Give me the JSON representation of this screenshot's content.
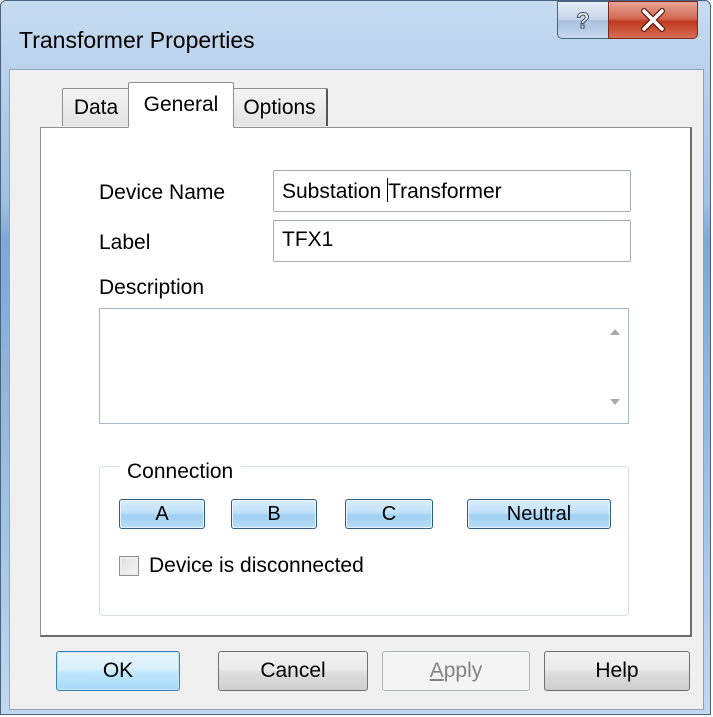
{
  "window": {
    "title": "Transformer Properties",
    "help_glyph": "?",
    "close_glyph": "X"
  },
  "tabs": [
    {
      "label": "Data"
    },
    {
      "label": "General"
    },
    {
      "label": "Options"
    }
  ],
  "general": {
    "device_name_label": "Device Name",
    "device_name_value_before_caret": "Substation ",
    "device_name_value_after_caret": "Transformer",
    "label_label": "Label",
    "label_value": "TFX1",
    "description_label": "Description",
    "description_value": ""
  },
  "connection": {
    "title": "Connection",
    "buttons": [
      {
        "label": "A"
      },
      {
        "label": "B"
      },
      {
        "label": "C"
      },
      {
        "label": "Neutral"
      }
    ],
    "disconnected_label": "Device is disconnected",
    "disconnected_checked": false
  },
  "footer": {
    "ok": "OK",
    "cancel": "Cancel",
    "apply_mnemonic": "A",
    "apply_rest": "pply",
    "help": "Help"
  }
}
